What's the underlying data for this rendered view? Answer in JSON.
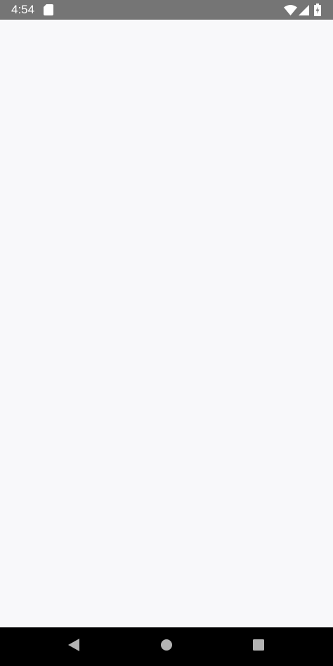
{
  "status_bar": {
    "time": "4:54",
    "background_color": "#757575",
    "icons": [
      "sd-card-icon",
      "wifi-icon",
      "cell-signal-icon",
      "battery-charging-icon"
    ]
  },
  "content": {
    "background_color": "#f8f8fa"
  },
  "nav_bar": {
    "background_color": "#000000",
    "buttons": [
      "back-icon",
      "home-icon",
      "recents-icon"
    ]
  }
}
